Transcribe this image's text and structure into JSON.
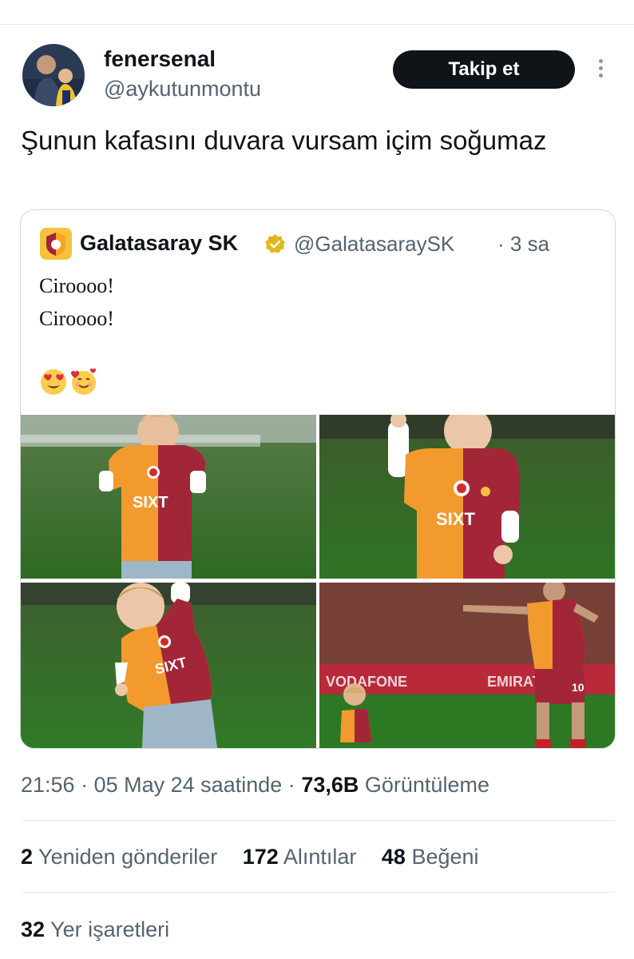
{
  "tweet": {
    "display_name": "fenersenal",
    "handle": "@aykutunmontu",
    "follow_label": "Takip et",
    "text": "Şunun kafasını duvara vursam içim soğumaz",
    "avatar_icon": "user-avatar-photo",
    "more_icon": "more-vertical-icon"
  },
  "quote": {
    "name": "Galatasaray SK",
    "handle": "@GalatasaraySK",
    "time": "· 3 sa",
    "line1": "Ciroooo!",
    "line2": "Ciroooo!",
    "verified_icon": "verified-badge-icon",
    "emojis": [
      "heart-eyes-emoji",
      "smiling-face-with-hearts-emoji"
    ]
  },
  "meta": {
    "time": "21:56",
    "sep1": "·",
    "date": "05 May 24 saatinde",
    "sep2": "·",
    "views_count": "73,6B",
    "views_label": "Görüntüleme"
  },
  "stats": {
    "reposts_count": "2",
    "reposts_label": "Yeniden gönderiler",
    "quotes_count": "172",
    "quotes_label": "Alıntılar",
    "likes_count": "48",
    "likes_label": "Beğeni",
    "bookmarks_count": "32",
    "bookmarks_label": "Yer işaretleri"
  },
  "colors": {
    "primary_text": "#0f1419",
    "secondary_text": "#536471",
    "border": "#cfd9de",
    "galatasaray_red": "#a32638",
    "galatasaray_yellow": "#f6a623"
  }
}
